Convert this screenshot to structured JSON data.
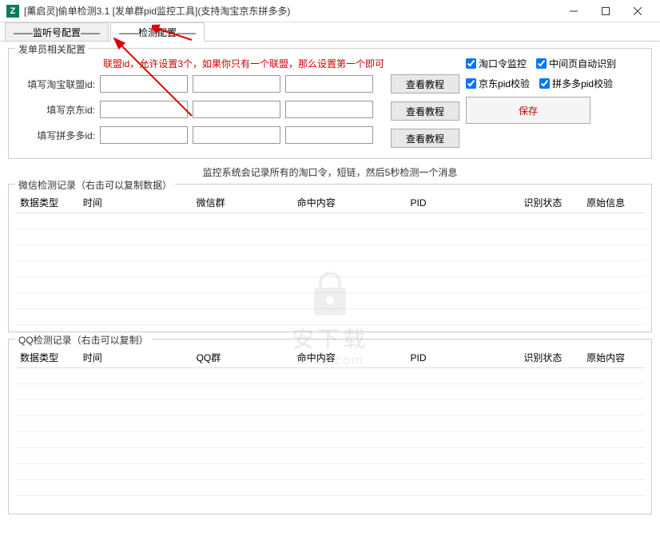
{
  "window": {
    "icon_letter": "Z",
    "title": "[薰启灵]偷单检测3.1  [发单群pid监控工具](支持淘宝京东拼多多)"
  },
  "tabs": {
    "listen": "——监听号配置——",
    "detect": "——检测配置——"
  },
  "fieldset_config": {
    "legend": "发单员相关配置",
    "hint": "联盟id，允许设置3个，如果你只有一个联盟，那么设置第一个即可",
    "labels": {
      "taobao": "填写淘宝联盟id:",
      "jd": "填写京东id:",
      "pdd": "填写拼多多id:"
    },
    "tutorial_btn": "查看教程",
    "checkboxes": {
      "tkl": "淘口令监控",
      "mid": "中间页自动识别",
      "jd": "京东pid校验",
      "pdd": "拼多多pid校验"
    },
    "save_btn": "保存"
  },
  "center_hint": "监控系统会记录所有的淘口令，短链，然后5秒检测一个消息",
  "wechat_table": {
    "legend": "微信检测记录（右击可以复制数据）",
    "headers": [
      "数据类型",
      "时间",
      "微信群",
      "命中内容",
      "PID",
      "识别状态",
      "原始信息"
    ]
  },
  "qq_table": {
    "legend": "QQ检测记录（右击可以复制）",
    "headers": [
      "数据类型",
      "时间",
      "QQ群",
      "命中内容",
      "PID",
      "识别状态",
      "原始内容"
    ]
  },
  "watermark": {
    "text": "安下载",
    "sub": "anxz.com"
  }
}
